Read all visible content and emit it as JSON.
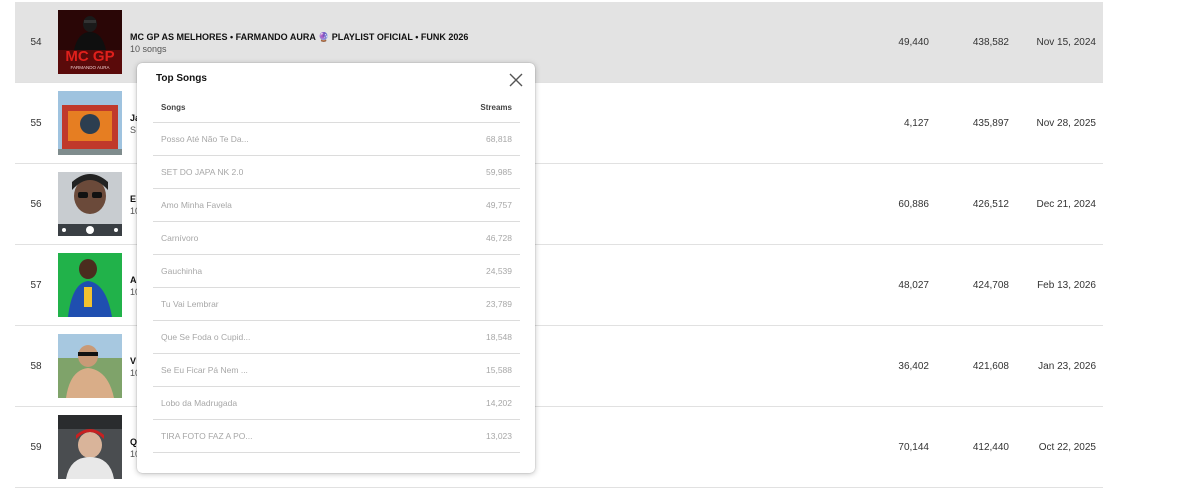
{
  "rows": [
    {
      "rank": "54",
      "title": "MC GP AS MELHORES • FARMANDO AURA 🔮 PLAYLIST OFICIAL • FUNK 2026",
      "subtitle": "10 songs",
      "c1": "49,440",
      "c2": "438,582",
      "date": "Nov 15, 2024",
      "thumb_text": "MC GP",
      "thumb_sub": "FARMANDO AURA"
    },
    {
      "rank": "55",
      "title": "Ja",
      "subtitle": "S",
      "c1": "4,127",
      "c2": "435,897",
      "date": "Nov 28, 2025"
    },
    {
      "rank": "56",
      "title": "E",
      "subtitle": "10",
      "c1": "60,886",
      "c2": "426,512",
      "date": "Dec 21, 2024"
    },
    {
      "rank": "57",
      "title": "A",
      "subtitle": "10",
      "c1": "48,027",
      "c2": "424,708",
      "date": "Feb 13, 2026"
    },
    {
      "rank": "58",
      "title": "V",
      "subtitle": "10",
      "c1": "36,402",
      "c2": "421,608",
      "date": "Jan 23, 2026"
    },
    {
      "rank": "59",
      "title": "Q",
      "subtitle": "10",
      "c1": "70,144",
      "c2": "412,440",
      "date": "Oct 22, 2025"
    }
  ],
  "popup": {
    "title": "Top Songs",
    "col_songs": "Songs",
    "col_streams": "Streams",
    "songs": [
      {
        "name": "Posso Até Não Te Da...",
        "streams": "68,818"
      },
      {
        "name": "SET DO JAPA NK 2.0",
        "streams": "59,985"
      },
      {
        "name": "Amo Minha Favela",
        "streams": "49,757"
      },
      {
        "name": "Carnívoro",
        "streams": "46,728"
      },
      {
        "name": "Gauchinha",
        "streams": "24,539"
      },
      {
        "name": "Tu Vai Lembrar",
        "streams": "23,789"
      },
      {
        "name": "Que Se Foda o Cupid...",
        "streams": "18,548"
      },
      {
        "name": "Se Eu Ficar Pá Nem ...",
        "streams": "15,588"
      },
      {
        "name": "Lobo da Madrugada",
        "streams": "14,202"
      },
      {
        "name": "TIRA FOTO FAZ A PO...",
        "streams": "13,023"
      }
    ]
  },
  "icons": {
    "close": "close-icon"
  },
  "colors": {
    "highlight_row": "#e3e3e3",
    "mc_gp_red": "#e0201c"
  }
}
